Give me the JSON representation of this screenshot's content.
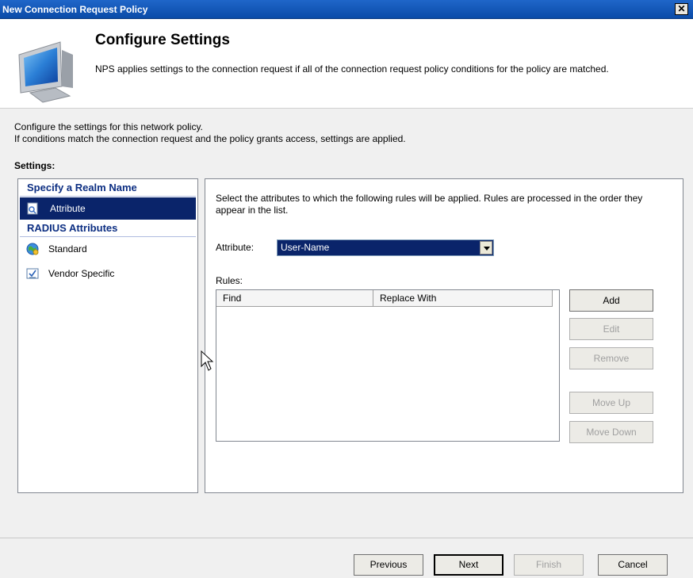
{
  "window": {
    "title": "New Connection Request Policy",
    "close_glyph": "✕"
  },
  "header": {
    "title": "Configure Settings",
    "description": "NPS applies settings to the connection request if all of the connection request policy conditions for the policy are matched.",
    "icon": "computer-monitor-icon"
  },
  "intro": {
    "line1": "Configure the settings for this network policy.",
    "line2": "If conditions match the connection request and the policy grants access, settings are applied."
  },
  "settings_label": "Settings:",
  "sidebar": {
    "groups": [
      {
        "header": "Specify a Realm Name",
        "items": [
          {
            "label": "Attribute",
            "icon": "attribute-document-icon",
            "selected": true
          }
        ]
      },
      {
        "header": "RADIUS Attributes",
        "items": [
          {
            "label": "Standard",
            "icon": "globe-icon",
            "selected": false
          },
          {
            "label": "Vendor Specific",
            "icon": "checkbox-icon",
            "selected": false
          }
        ]
      }
    ]
  },
  "main": {
    "description": "Select the attributes to which the following rules will be applied. Rules are processed in the order they appear in the list.",
    "attribute_label": "Attribute:",
    "attribute_value": "User-Name",
    "rules_label": "Rules:",
    "columns": [
      "Find",
      "Replace With"
    ],
    "rows": [],
    "buttons": {
      "add": "Add",
      "edit": "Edit",
      "remove": "Remove",
      "move_up": "Move Up",
      "move_down": "Move Down"
    }
  },
  "footer": {
    "previous": "Previous",
    "next": "Next",
    "finish": "Finish",
    "cancel": "Cancel"
  },
  "colors": {
    "selection": "#0a246a",
    "titlebar": "#1f66c9",
    "group_header": "#0c2e82"
  }
}
